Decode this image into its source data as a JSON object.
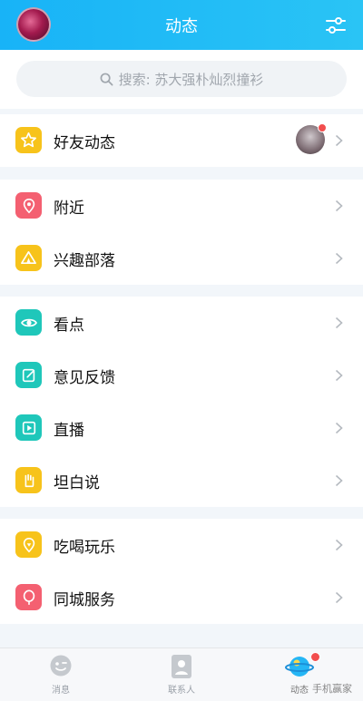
{
  "header": {
    "title": "动态"
  },
  "search": {
    "text": "搜索: 苏大强朴灿烈撞衫"
  },
  "sections": [
    {
      "items": [
        {
          "label": "好友动态",
          "icon": "friend-feed-star-icon",
          "color": "#f7c31b"
        }
      ]
    },
    {
      "items": [
        {
          "label": "附近",
          "icon": "location-pin-icon",
          "color": "#f46071"
        },
        {
          "label": "兴趣部落",
          "icon": "tribe-tent-icon",
          "color": "#f7c31b"
        }
      ]
    },
    {
      "items": [
        {
          "label": "看点",
          "icon": "eye-icon",
          "color": "#1fc7ba"
        },
        {
          "label": "意见反馈",
          "icon": "feedback-edit-icon",
          "color": "#1fc7ba"
        },
        {
          "label": "直播",
          "icon": "live-play-icon",
          "color": "#1fc7ba"
        },
        {
          "label": "坦白说",
          "icon": "hand-icon",
          "color": "#f7c31b"
        }
      ]
    },
    {
      "items": [
        {
          "label": "吃喝玩乐",
          "icon": "food-leisure-icon",
          "color": "#f7c31b"
        },
        {
          "label": "同城服务",
          "icon": "balloon-icon",
          "color": "#f46071"
        }
      ]
    }
  ],
  "tabs": [
    {
      "label": "消息",
      "icon": "message-icon"
    },
    {
      "label": "联系人",
      "icon": "contacts-icon"
    },
    {
      "label": "动态",
      "icon": "planet-icon"
    }
  ],
  "watermark": {
    "text": "手机赢家"
  }
}
